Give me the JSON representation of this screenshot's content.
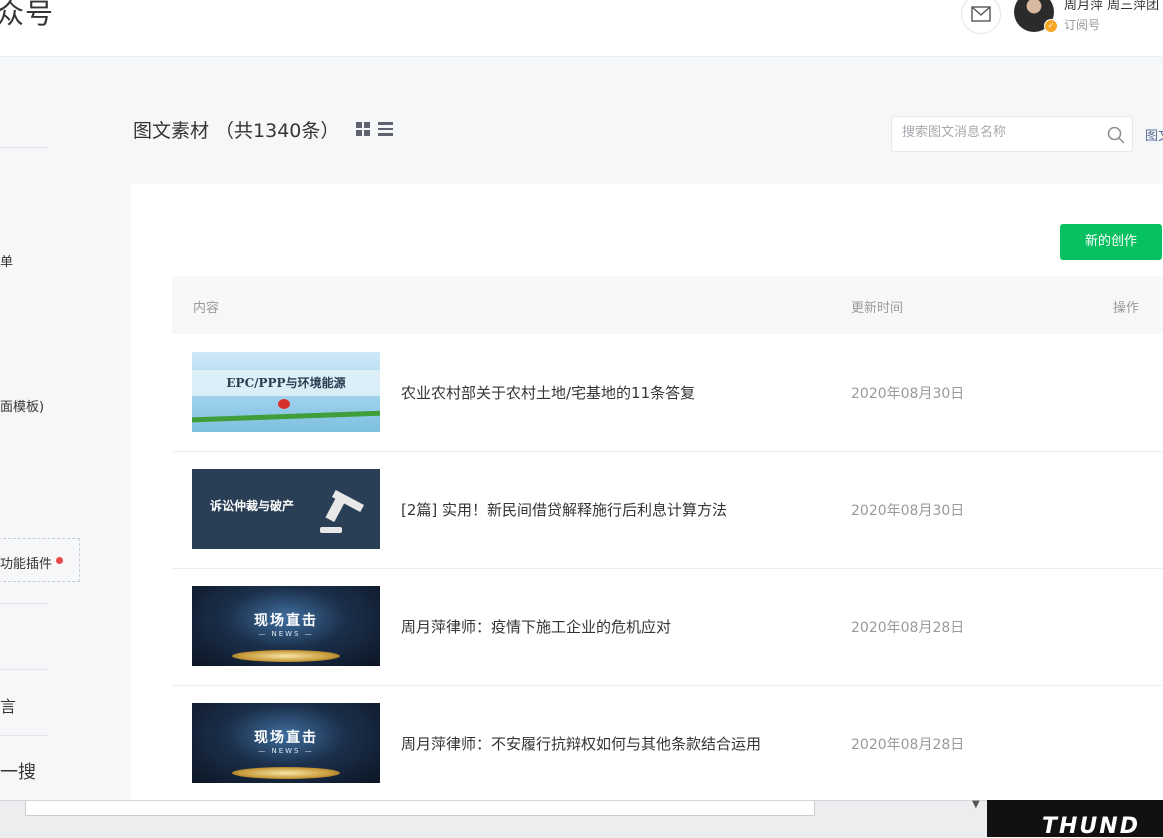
{
  "header": {
    "brand": "众号",
    "account_name": "周月萍 周三萍团",
    "account_type": "订阅号"
  },
  "sidebar": {
    "items": [
      {
        "label": "单"
      },
      {
        "label": "面模板)"
      },
      {
        "label": "功能插件"
      },
      {
        "label": "言"
      },
      {
        "label": "一搜"
      }
    ]
  },
  "main": {
    "title": "图文素材 （共1340条）",
    "search": {
      "placeholder": "搜索图文消息名称"
    },
    "edge_link": "图文",
    "new_button": "新的创作",
    "table": {
      "headers": {
        "content": "内容",
        "updated": "更新时间",
        "actions": "操作"
      },
      "rows": [
        {
          "thumb_text": "EPC/PPP与环境能源",
          "title": "农业农村部关于农村土地/宅基地的11条答复",
          "date": "2020年08月30日"
        },
        {
          "thumb_text": "诉讼仲裁与破产",
          "title": "[2篇] 实用！新民间借贷解释施行后利息计算方法",
          "date": "2020年08月30日"
        },
        {
          "thumb_text": "现场直击",
          "thumb_sub": "— NEWS —",
          "title": "周月萍律师：疫情下施工企业的危机应对",
          "date": "2020年08月28日"
        },
        {
          "thumb_text": "现场直击",
          "thumb_sub": "— NEWS —",
          "title": "周月萍律师：不安履行抗辩权如何与其他条款结合运用",
          "date": "2020年08月28日"
        }
      ]
    }
  },
  "colors": {
    "primary_button": "#07c160",
    "link": "#576b95",
    "notice_dot": "#e84a4a"
  },
  "icons": [
    "mail-icon",
    "verified-badge-icon",
    "grid-view-icon",
    "list-view-icon",
    "search-icon"
  ]
}
